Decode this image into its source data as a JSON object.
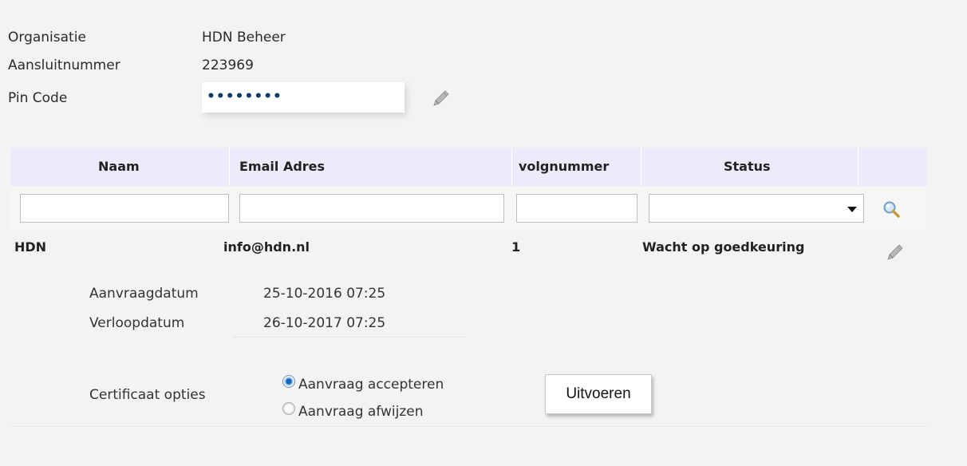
{
  "account": {
    "organisatie_label": "Organisatie",
    "organisatie_value": "HDN Beheer",
    "aansluitnummer_label": "Aansluitnummer",
    "aansluitnummer_value": "223969",
    "pincode_label": "Pin Code",
    "pincode_value": "••••••••"
  },
  "grid": {
    "columns": [
      "Naam",
      "Email Adres",
      "volgnummer",
      "Status"
    ],
    "filters": {
      "naam": "",
      "email": "",
      "volgnummer": "",
      "status_selected": ""
    },
    "rows": [
      {
        "naam": "HDN",
        "email": "info@hdn.nl",
        "volgnummer": "1",
        "status": "Wacht op goedkeuring"
      }
    ]
  },
  "details": {
    "aanvraagdatum_label": "Aanvraagdatum",
    "aanvraagdatum_value": "25-10-2016 07:25",
    "verloopdatum_label": "Verloopdatum",
    "verloopdatum_value": "26-10-2017 07:25",
    "opties_label": "Certificaat opties",
    "options": [
      {
        "label": "Aanvraag accepteren",
        "selected": true
      },
      {
        "label": "Aanvraag afwijzen",
        "selected": false
      }
    ],
    "submit_label": "Uitvoeren"
  },
  "icons": {
    "pincode_edit": "pencil-icon",
    "search": "magnifier-icon",
    "row_edit": "pencil-icon"
  },
  "colors": {
    "header_bg": "#ebebfb",
    "pin_dots": "#0f3c66",
    "radio_selected": "#1565c0"
  }
}
